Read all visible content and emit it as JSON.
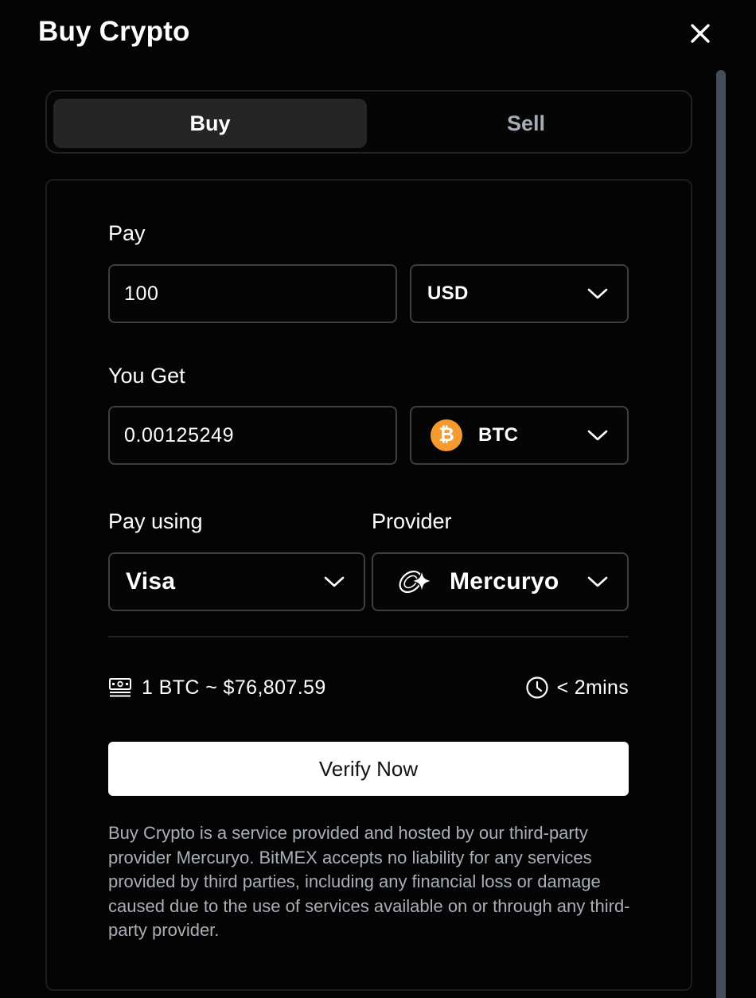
{
  "modal": {
    "title": "Buy Crypto"
  },
  "tabs": [
    {
      "label": "Buy",
      "active": true
    },
    {
      "label": "Sell",
      "active": false
    }
  ],
  "pay": {
    "label": "Pay",
    "amount": "100",
    "currency": "USD"
  },
  "receive": {
    "label": "You Get",
    "amount": "0.00125249",
    "currency": "BTC",
    "currency_icon": "bitcoin-icon"
  },
  "payment": {
    "label": "Pay using",
    "method": "Visa"
  },
  "provider": {
    "label": "Provider",
    "name": "Mercuryo",
    "icon": "mercuryo-logo-icon"
  },
  "rate": {
    "text": "1 BTC ~ $76,807.59",
    "icon": "cash-icon"
  },
  "eta": {
    "text": "< 2mins",
    "icon": "clock-icon"
  },
  "actions": {
    "verify_label": "Verify Now"
  },
  "disclaimer": "Buy Crypto is a service provided and hosted by our third-party provider Mercuryo. BitMEX accepts no liability for any services provided by third parties, including any financial loss or damage caused due to the use of services available on or through any third-party provider.",
  "colors": {
    "background": "#040405",
    "tab_active": "#252526",
    "field_border": "#3a3f47",
    "btc_orange": "#f49a31",
    "button_bg": "#ffffff",
    "muted_text": "#a9aeb7"
  }
}
